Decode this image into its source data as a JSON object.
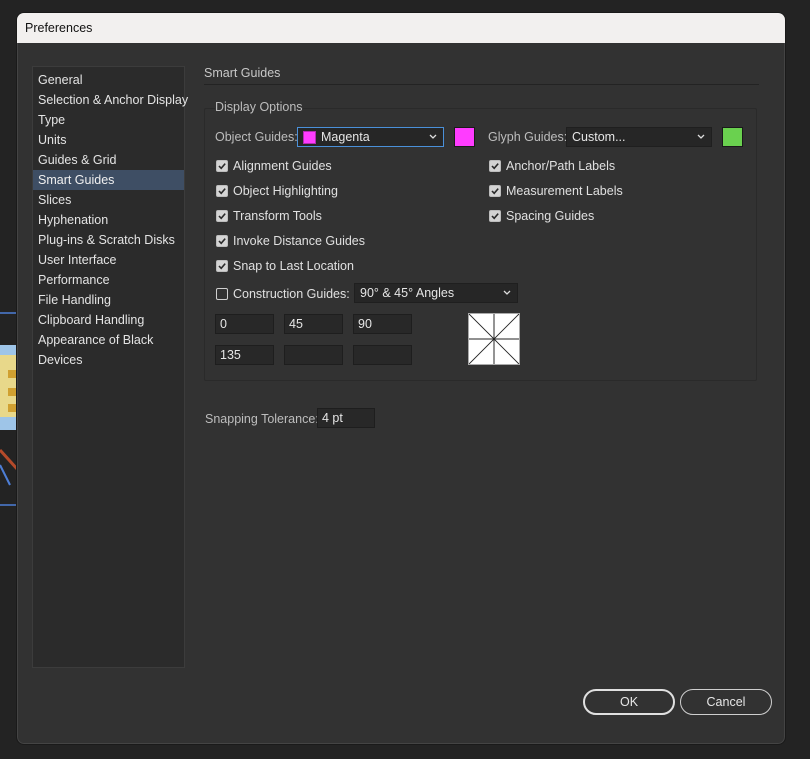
{
  "window": {
    "title": "Preferences"
  },
  "sidebar": {
    "items": [
      {
        "label": "General"
      },
      {
        "label": "Selection & Anchor Display"
      },
      {
        "label": "Type"
      },
      {
        "label": "Units"
      },
      {
        "label": "Guides & Grid"
      },
      {
        "label": "Smart Guides",
        "active": true
      },
      {
        "label": "Slices"
      },
      {
        "label": "Hyphenation"
      },
      {
        "label": "Plug-ins & Scratch Disks"
      },
      {
        "label": "User Interface"
      },
      {
        "label": "Performance"
      },
      {
        "label": "File Handling"
      },
      {
        "label": "Clipboard Handling"
      },
      {
        "label": "Appearance of Black"
      },
      {
        "label": "Devices"
      }
    ]
  },
  "main": {
    "section_title": "Smart Guides",
    "display_options": {
      "label": "Display Options",
      "object_guides": {
        "label": "Object Guides:",
        "value": "Magenta",
        "color": "#ff3cff"
      },
      "glyph_guides": {
        "label": "Glyph Guides:",
        "value": "Custom...",
        "color": "#6ad14f"
      },
      "left_checks": [
        {
          "label": "Alignment Guides",
          "checked": true
        },
        {
          "label": "Object Highlighting",
          "checked": true
        },
        {
          "label": "Transform Tools",
          "checked": true
        },
        {
          "label": "Invoke Distance Guides",
          "checked": true
        },
        {
          "label": "Snap to Last Location",
          "checked": true
        }
      ],
      "right_checks": [
        {
          "label": "Anchor/Path Labels",
          "checked": true
        },
        {
          "label": "Measurement Labels",
          "checked": true
        },
        {
          "label": "Spacing Guides",
          "checked": true
        }
      ],
      "construction": {
        "label": "Construction Guides:",
        "checked": false,
        "value": "90° & 45° Angles"
      },
      "angles": [
        "0",
        "45",
        "90",
        "135",
        "",
        ""
      ]
    },
    "snapping": {
      "label": "Snapping Tolerance:",
      "value": "4 pt"
    }
  },
  "buttons": {
    "ok": "OK",
    "cancel": "Cancel"
  },
  "icons": {
    "checkbox_check": "checkmark-icon",
    "dropdown": "chevron-down-icon"
  }
}
